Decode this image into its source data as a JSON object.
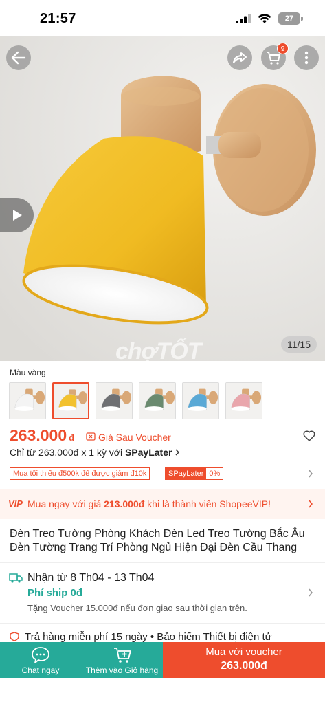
{
  "status": {
    "time": "21:57",
    "battery": "27"
  },
  "hero": {
    "image_counter": "11/15",
    "watermark": "chợTỐT",
    "cart_count": "9"
  },
  "variants": {
    "label": "Màu vàng",
    "colors": [
      "#f4f4f4",
      "#f2c12e",
      "#6f7073",
      "#6a8a6f",
      "#5aa9d6",
      "#e9a6ac"
    ],
    "selected_index": 1
  },
  "price": {
    "value": "263.000",
    "unit": "đ",
    "after_voucher": "Giá Sau Voucher",
    "spaylater_prefix": "Chỉ từ 263.000đ x 1 kỳ với ",
    "spaylater_brand": "SPayLater"
  },
  "promo": {
    "min_order": "Mua tối thiểu đ500k để được giảm đ10k",
    "spaylater": "SPayLater",
    "percent": "0%"
  },
  "vip": {
    "badge": "VIP",
    "prefix": "Mua ngay với giá ",
    "price": "213.000đ",
    "suffix": " khi là thành viên ShopeeVIP!"
  },
  "product": {
    "title": "Đèn Treo Tường Phòng Khách Đèn Led Treo Tường Bắc Âu Đèn Tường Trang Trí Phòng Ngủ Hiện Đại Đèn Cầu Thang"
  },
  "shipping": {
    "date": "Nhận từ 8 Th04 - 13 Th04",
    "fee": "Phí ship 0đ",
    "voucher": "Tặng Voucher 15.000đ nếu đơn giao sau thời gian trên."
  },
  "guarantee": {
    "text": "Trả hàng miễn phí 15 ngày  •  Bảo hiểm Thiết bị điện tử"
  },
  "bottom": {
    "chat": "Chat ngay",
    "add_cart": "Thêm vào Giỏ hàng",
    "buy": "Mua với voucher",
    "buy_price": "263.000đ"
  },
  "colors": {
    "brand": "#ee4d2d",
    "teal": "#26aa99",
    "lamp_yellow": "#f2c12e",
    "wood": "#d9a877"
  }
}
